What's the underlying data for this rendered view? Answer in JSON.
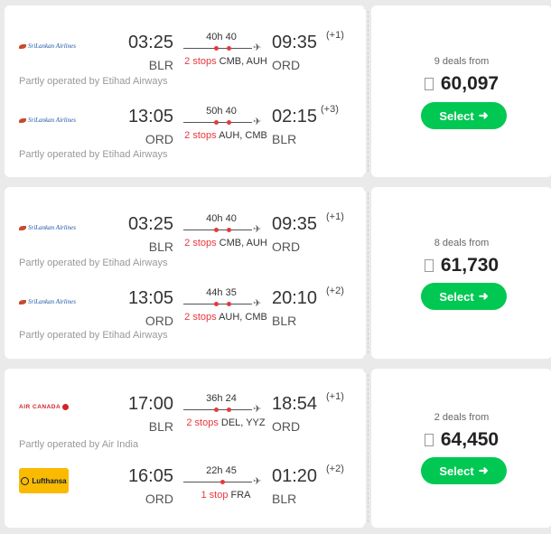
{
  "results": [
    {
      "legs": [
        {
          "airline": "SriLankan Airlines",
          "dep_time": "03:25",
          "arr_time": "09:35",
          "day_offset": "(+1)",
          "dep_code": "BLR",
          "arr_code": "ORD",
          "duration": "40h 40",
          "stops_label": "2 stops",
          "stops_via": "CMB, AUH",
          "operated_by": "Partly operated by Etihad Airways"
        },
        {
          "airline": "SriLankan Airlines",
          "dep_time": "13:05",
          "arr_time": "02:15",
          "day_offset": "(+3)",
          "dep_code": "ORD",
          "arr_code": "BLR",
          "duration": "50h 40",
          "stops_label": "2 stops",
          "stops_via": "AUH, CMB",
          "operated_by": "Partly operated by Etihad Airways"
        }
      ],
      "deals": "9 deals from",
      "price": "60,097",
      "select_label": "Select"
    },
    {
      "legs": [
        {
          "airline": "SriLankan Airlines",
          "dep_time": "03:25",
          "arr_time": "09:35",
          "day_offset": "(+1)",
          "dep_code": "BLR",
          "arr_code": "ORD",
          "duration": "40h 40",
          "stops_label": "2 stops",
          "stops_via": "CMB, AUH",
          "operated_by": "Partly operated by Etihad Airways"
        },
        {
          "airline": "SriLankan Airlines",
          "dep_time": "13:05",
          "arr_time": "20:10",
          "day_offset": "(+2)",
          "dep_code": "ORD",
          "arr_code": "BLR",
          "duration": "44h 35",
          "stops_label": "2 stops",
          "stops_via": "AUH, CMB",
          "operated_by": "Partly operated by Etihad Airways"
        }
      ],
      "deals": "8 deals from",
      "price": "61,730",
      "select_label": "Select"
    },
    {
      "legs": [
        {
          "airline": "AIR CANADA",
          "dep_time": "17:00",
          "arr_time": "18:54",
          "day_offset": "(+1)",
          "dep_code": "BLR",
          "arr_code": "ORD",
          "duration": "36h 24",
          "stops_label": "2 stops",
          "stops_via": "DEL, YYZ",
          "operated_by": "Partly operated by Air India"
        },
        {
          "airline": "Lufthansa",
          "dep_time": "16:05",
          "arr_time": "01:20",
          "day_offset": "(+2)",
          "dep_code": "ORD",
          "arr_code": "BLR",
          "duration": "22h 45",
          "stops_label": "1 stop",
          "stops_via": "FRA",
          "operated_by": ""
        }
      ],
      "deals": "2 deals from",
      "price": "64,450",
      "select_label": "Select"
    }
  ],
  "icons": {
    "plane": "plane-icon",
    "arrow": "arrow-right-icon",
    "currency": "currency-icon"
  },
  "colors": {
    "accent": "#00c852",
    "stop_dot": "#e8383d"
  }
}
